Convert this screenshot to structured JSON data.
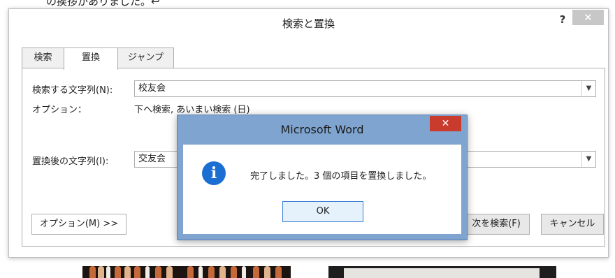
{
  "document": {
    "text_fragment": "の挨拶がありました。↩"
  },
  "dialog": {
    "title": "検索と置換",
    "help_label": "?",
    "close_label": "✕",
    "tabs": [
      {
        "label": "検索",
        "active": false
      },
      {
        "label": "置換",
        "active": true
      },
      {
        "label": "ジャンプ",
        "active": false
      }
    ],
    "find": {
      "label": "検索する文字列(N):",
      "value": "校友会"
    },
    "options": {
      "label": "オプション：",
      "value": "下へ検索, あいまい検索 (日)"
    },
    "replace": {
      "label": "置換後の文字列(I):",
      "value": "交友会"
    },
    "buttons": {
      "more_options": "オプション(M) >>",
      "find_next": "次を検索(F)",
      "cancel": "キャンセル"
    }
  },
  "message_box": {
    "title": "Microsoft Word",
    "close_label": "✕",
    "icon": "info-icon",
    "message": "完了しました。3 個の項目を置換しました。",
    "ok_label": "OK"
  },
  "colors": {
    "msgbox_frame": "#7fa4d0",
    "msgbox_close": "#c93b2c",
    "info_icon": "#1b6fd3",
    "ok_border": "#3c7fd6"
  }
}
